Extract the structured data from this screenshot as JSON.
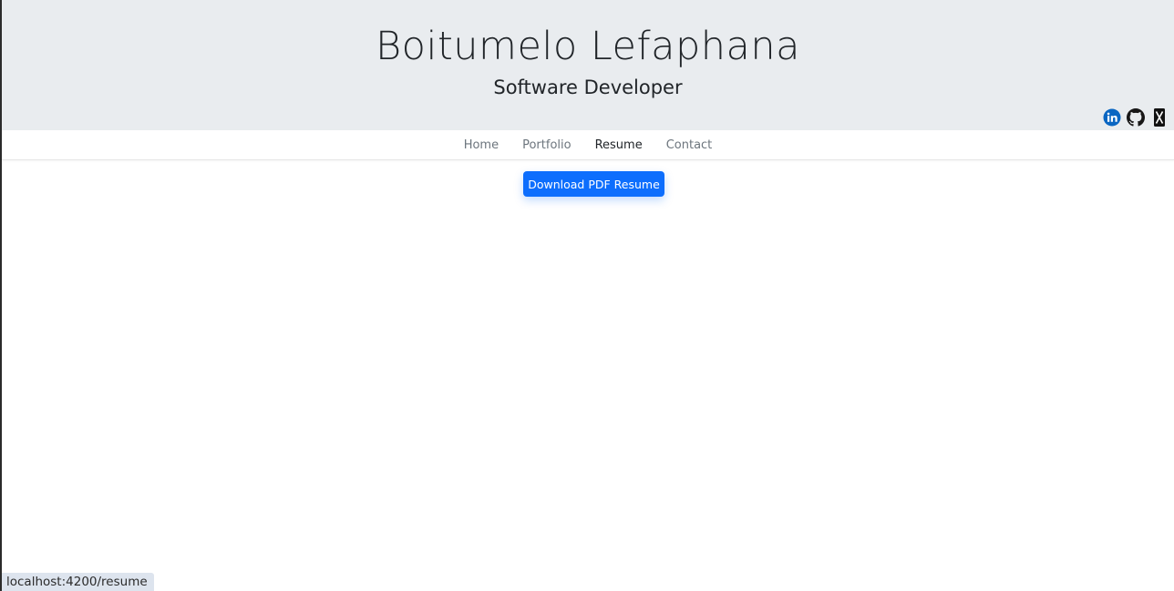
{
  "hero": {
    "name": "Boitumelo Lefaphana",
    "title": "Software Developer"
  },
  "social": {
    "items": [
      {
        "name": "linkedin-icon",
        "color": "#0a66c2"
      },
      {
        "name": "github-icon",
        "color": "#181717"
      },
      {
        "name": "x-icon",
        "color": "#000000"
      }
    ]
  },
  "nav": {
    "items": [
      {
        "label": "Home",
        "active": false
      },
      {
        "label": "Portfolio",
        "active": false
      },
      {
        "label": "Resume",
        "active": true
      },
      {
        "label": "Contact",
        "active": false
      }
    ]
  },
  "main": {
    "download_label": "Download PDF Resume",
    "button_color": "#0d6efd"
  },
  "status_bar": {
    "url": "localhost:4200/resume"
  }
}
